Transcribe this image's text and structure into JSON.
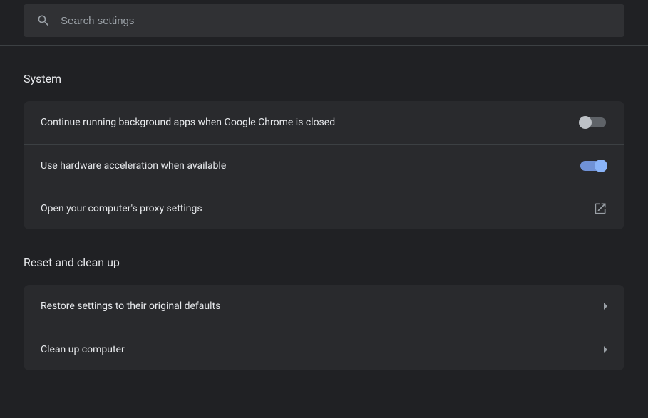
{
  "search": {
    "placeholder": "Search settings"
  },
  "sections": {
    "system": {
      "title": "System",
      "rows": {
        "background_apps": {
          "label": "Continue running background apps when Google Chrome is closed",
          "toggle": false
        },
        "hardware_accel": {
          "label": "Use hardware acceleration when available",
          "toggle": true
        },
        "proxy": {
          "label": "Open your computer's proxy settings"
        }
      }
    },
    "reset": {
      "title": "Reset and clean up",
      "rows": {
        "restore": {
          "label": "Restore settings to their original defaults"
        },
        "cleanup": {
          "label": "Clean up computer"
        }
      }
    }
  }
}
